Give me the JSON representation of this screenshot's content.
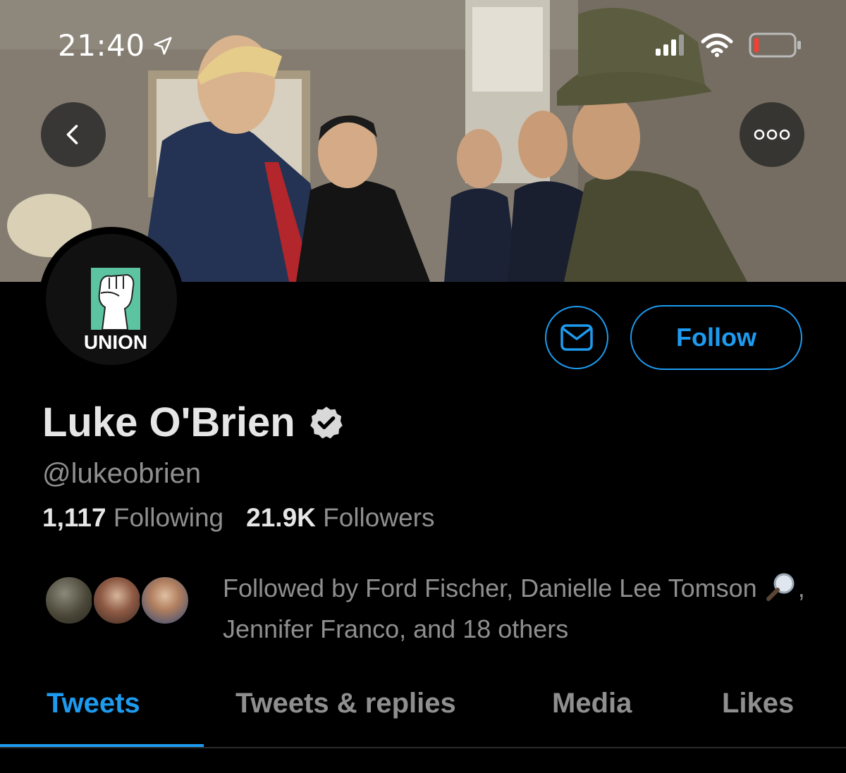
{
  "status_bar": {
    "time": "21:40",
    "location_icon": "location-arrow-icon",
    "signal_icon": "cellular-signal-icon",
    "wifi_icon": "wifi-icon",
    "battery_icon": "battery-low-icon"
  },
  "header": {
    "back_icon": "chevron-left-icon",
    "more_icon": "more-horizontal-icon"
  },
  "avatar": {
    "logo_text": "UNION",
    "logo_icon": "raised-fist-icon"
  },
  "actions": {
    "message_icon": "envelope-icon",
    "follow_label": "Follow"
  },
  "profile": {
    "name": "Luke O'Brien",
    "verified_icon": "verified-badge-icon",
    "handle": "@lukeobrien",
    "following_count": "1,117",
    "following_label": "Following",
    "followers_count": "21.9K",
    "followers_label": "Followers"
  },
  "followed_by": {
    "text_before": "Followed by Ford Fischer, Danielle Lee Tomson ",
    "emoji_icon": "magnifying-glass-icon",
    "text_after": ", Jennifer Franco, and 18 others"
  },
  "tabs": [
    {
      "label": "Tweets",
      "active": true
    },
    {
      "label": "Tweets & replies",
      "active": false
    },
    {
      "label": "Media",
      "active": false
    },
    {
      "label": "Likes",
      "active": false
    }
  ],
  "colors": {
    "accent": "#1d9bf0",
    "background": "#000000",
    "muted": "#8f8f8f"
  }
}
